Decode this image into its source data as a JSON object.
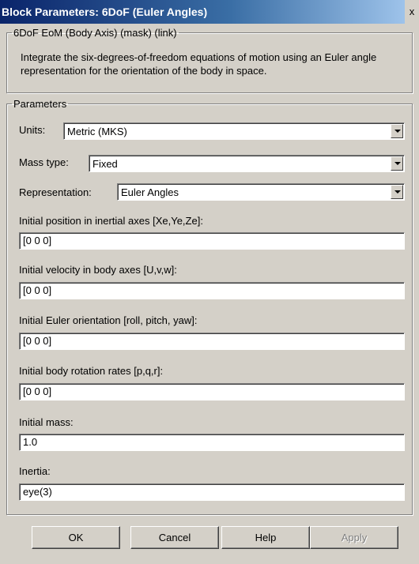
{
  "window": {
    "title": "Block Parameters: 6DoF (Euler Angles)",
    "close_glyph": "x"
  },
  "description_group": {
    "legend": "6DoF EoM (Body Axis) (mask) (link)",
    "text": "Integrate the six-degrees-of-freedom equations of motion using an Euler angle representation for the orientation of the body in space."
  },
  "parameters": {
    "legend": "Parameters",
    "units": {
      "label": "Units:",
      "value": "Metric (MKS)"
    },
    "mass_type": {
      "label": "Mass type:",
      "value": "Fixed"
    },
    "representation": {
      "label": "Representation:",
      "value": "Euler Angles"
    },
    "fields": [
      {
        "label": "Initial position in inertial axes [Xe,Ye,Ze]:",
        "value": "[0 0 0]"
      },
      {
        "label": "Initial velocity in body axes [U,v,w]:",
        "value": "[0 0 0]"
      },
      {
        "label": "Initial Euler orientation [roll, pitch, yaw]:",
        "value": "[0 0 0]"
      },
      {
        "label": "Initial body rotation rates [p,q,r]:",
        "value": "[0 0 0]"
      },
      {
        "label": "Initial mass:",
        "value": "1.0"
      },
      {
        "label": "Inertia:",
        "value": "eye(3)"
      }
    ]
  },
  "buttons": {
    "ok": "OK",
    "cancel": "Cancel",
    "help": "Help",
    "apply": "Apply"
  }
}
